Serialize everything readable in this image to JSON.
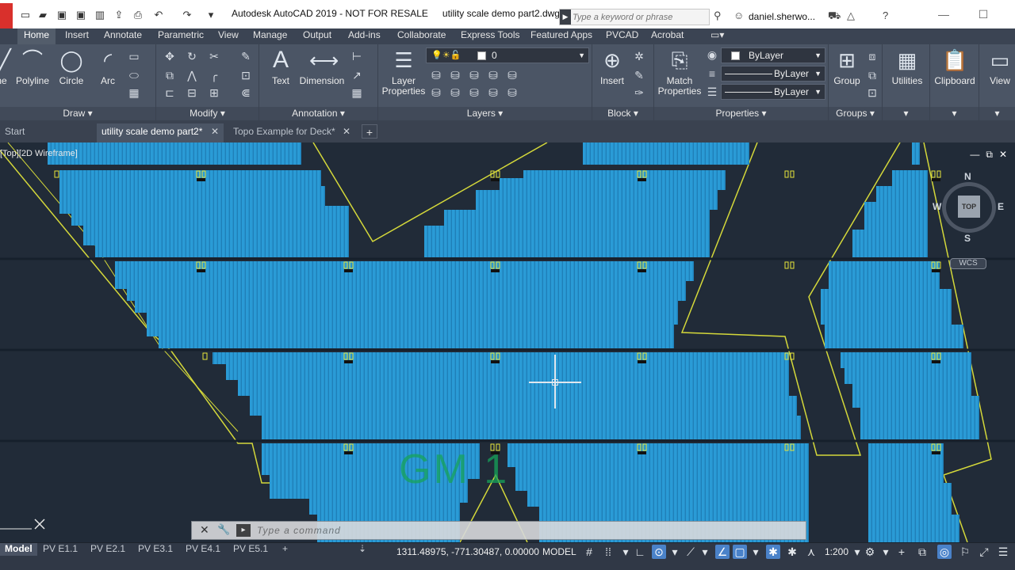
{
  "titlebar": {
    "app_title": "Autodesk AutoCAD 2019 - NOT FOR RESALE",
    "file_title": "utility scale demo part2.dwg",
    "search_placeholder": "Type a keyword or phrase",
    "user": "daniel.sherwo..."
  },
  "ribbon_tabs": [
    "Home",
    "Insert",
    "Annotate",
    "Parametric",
    "View",
    "Manage",
    "Output",
    "Add-ins",
    "Collaborate",
    "Express Tools",
    "Featured Apps",
    "PVCAD",
    "Acrobat"
  ],
  "ribbon": {
    "draw": {
      "line_partial": "ne",
      "polyline": "Polyline",
      "circle": "Circle",
      "arc": "Arc",
      "panel": "Draw"
    },
    "modify": {
      "panel": "Modify"
    },
    "annotation": {
      "text": "Text",
      "dimension": "Dimension",
      "panel": "Annotation"
    },
    "layers": {
      "layer_properties_1": "Layer",
      "layer_properties_2": "Properties",
      "current_layer": "0",
      "panel": "Layers"
    },
    "block": {
      "insert": "Insert",
      "panel": "Block"
    },
    "properties": {
      "match_1": "Match",
      "match_2": "Properties",
      "color": "ByLayer",
      "linetype": "ByLayer",
      "lineweight": "ByLayer",
      "panel": "Properties"
    },
    "groups": {
      "group": "Group",
      "panel": "Groups"
    },
    "utilities": "Utilities",
    "clipboard": "Clipboard",
    "view": "View"
  },
  "file_tabs": {
    "start": "Start",
    "active": "utility scale demo part2*",
    "other": "Topo Example for Deck*"
  },
  "viewport": {
    "label": "[Top][2D Wireframe]",
    "compass": {
      "n": "N",
      "w": "W",
      "e": "E",
      "s": "S"
    },
    "cube_face": "TOP",
    "wcs": "WCS",
    "block_label": "GM 1"
  },
  "command": {
    "placeholder": "Type a command"
  },
  "layout_tabs": [
    "Model",
    "PV E1.1",
    "PV E2.1",
    "PV E3.1",
    "PV E4.1",
    "PV E5.1"
  ],
  "statusbar": {
    "coordinates": "1311.48975, -771.30487, 0.00000",
    "mode": "MODEL",
    "scale": "1:200"
  },
  "colors": {
    "pv_array": "#2a9bd6",
    "boundary": "#d4d83a",
    "canvas": "#212b38",
    "label": "#16a35a"
  }
}
